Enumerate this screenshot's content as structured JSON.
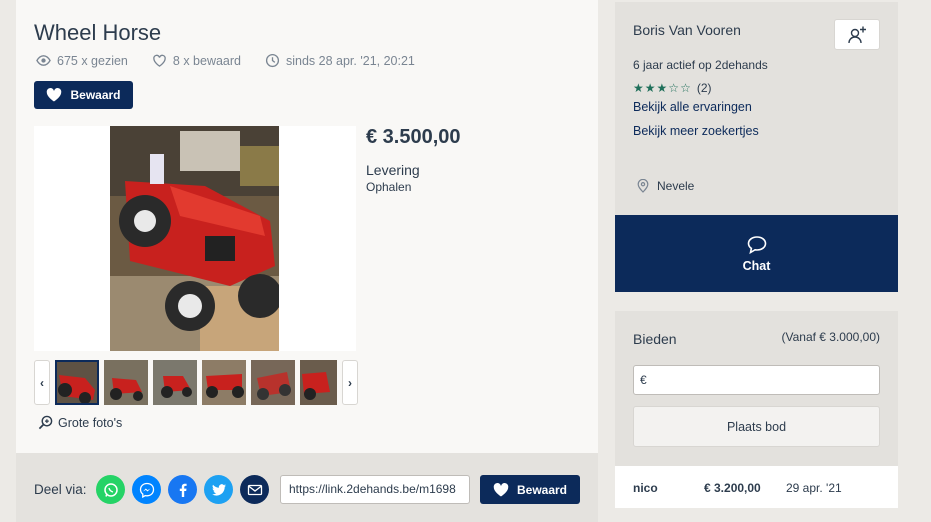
{
  "listing": {
    "title": "Wheel Horse",
    "views": "675 x gezien",
    "saves": "8 x bewaard",
    "since": "sinds 28 apr. '21, 20:21",
    "saved_label": "Bewaard",
    "price": "€ 3.500,00",
    "delivery_label": "Levering",
    "delivery_value": "Ophalen",
    "big_photos_label": "Grote foto's",
    "thumbnails": [
      "photo-1",
      "photo-2",
      "photo-3",
      "photo-4",
      "photo-5",
      "photo-6"
    ]
  },
  "share": {
    "label": "Deel via:",
    "url": "https://link.2dehands.be/m1698",
    "saved_label": "Bewaard",
    "networks": [
      "whatsapp",
      "messenger",
      "facebook",
      "twitter",
      "email"
    ]
  },
  "seller": {
    "name": "Boris Van Vooren",
    "active": "6 jaar actief op 2dehands",
    "rating_count": "(2)",
    "rating_stars": 3,
    "link_experiences": "Bekijk alle ervaringen",
    "link_more": "Bekijk meer zoekertjes",
    "location": "Nevele"
  },
  "chat": {
    "label": "Chat"
  },
  "bidding": {
    "title": "Bieden",
    "minimum": "(Vanaf € 3.000,00)",
    "input_value": "€",
    "button_label": "Plaats bod",
    "bids": [
      {
        "user": "nico",
        "amount": "€ 3.200,00",
        "date": "29 apr. '21"
      }
    ]
  },
  "colors": {
    "brand_navy": "#0c2a5a",
    "star_green": "#1f6f5a",
    "whatsapp": "#25d366",
    "messenger": "#0084ff",
    "facebook": "#1877f2",
    "twitter": "#1da1f2",
    "email": "#0c2a5a"
  }
}
